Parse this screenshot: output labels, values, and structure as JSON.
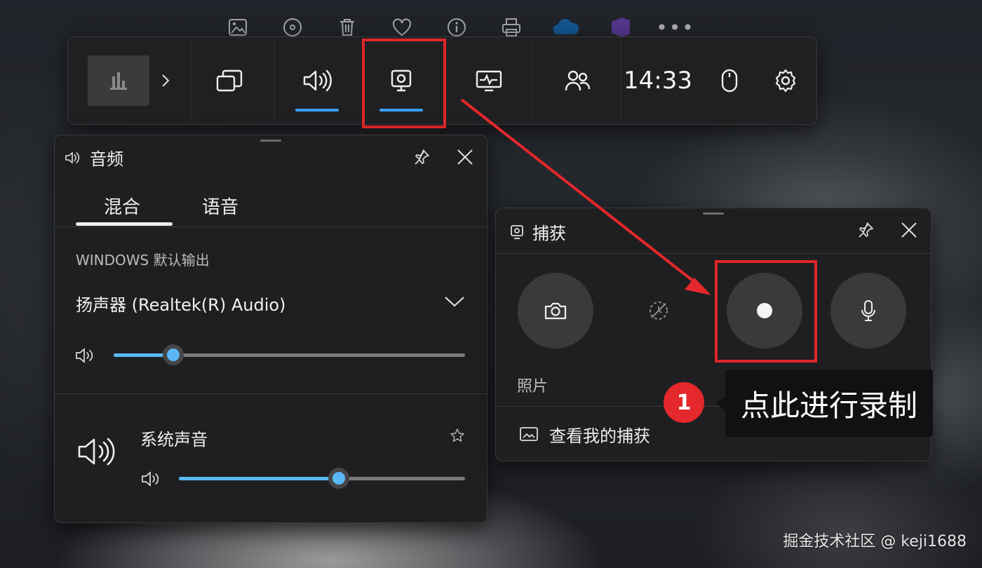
{
  "topbar": {
    "icons": [
      "image-edit-icon",
      "disc-icon",
      "trash-icon",
      "heart-icon",
      "info-icon",
      "print-icon",
      "cloud-icon",
      "app-icon",
      "more-icon"
    ],
    "more_label": "•••"
  },
  "gamebar": {
    "items": [
      {
        "name": "widget-menu",
        "icon": "widget-thumb-icon"
      },
      {
        "name": "expand",
        "icon": "chevron-right-icon"
      },
      {
        "name": "gallery",
        "icon": "gallery-icon"
      },
      {
        "name": "audio",
        "icon": "speaker-icon",
        "active": true
      },
      {
        "name": "capture",
        "icon": "capture-icon",
        "active": true
      },
      {
        "name": "performance",
        "icon": "performance-icon"
      },
      {
        "name": "social",
        "icon": "people-icon"
      },
      {
        "name": "mouse",
        "icon": "mouse-icon"
      },
      {
        "name": "settings",
        "icon": "gear-icon"
      }
    ],
    "time": "14:33",
    "accent": "#3aa0ff",
    "highlight_color": "#e0262a"
  },
  "audio_panel": {
    "title": "音频",
    "tabs": [
      {
        "label": "混合",
        "selected": true
      },
      {
        "label": "语音",
        "selected": false
      }
    ],
    "default_output_label": "WINDOWS 默认输出",
    "device": "扬声器 (Realtek(R) Audio)",
    "master_volume": 0.17,
    "apps": [
      {
        "name": "系统声音",
        "volume": 0.56,
        "favorite": false
      }
    ],
    "next_app_partial": "",
    "slider_color": "#5ab8f7"
  },
  "capture_panel": {
    "title": "捕获",
    "buttons": [
      {
        "name": "screenshot",
        "icon": "camera-icon"
      },
      {
        "name": "record-last",
        "icon": "record-last-disabled-icon"
      },
      {
        "name": "record",
        "icon": "record-icon"
      },
      {
        "name": "microphone",
        "icon": "microphone-icon"
      }
    ],
    "photo_label": "照片",
    "view_captures_label": "查看我的捕获"
  },
  "annotation": {
    "step_number": "1",
    "callout_text": "点此进行录制",
    "badge_color": "#e4282c"
  },
  "watermark": "掘金技术社区 @ keji1688"
}
